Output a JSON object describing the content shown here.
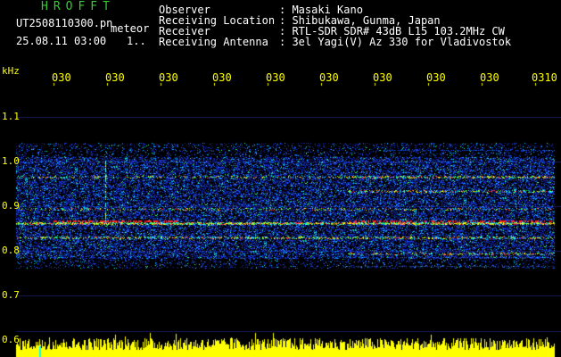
{
  "header": {
    "brand": "HROFFT",
    "file": "UT2508110300.pn",
    "meteor_label": "meteor",
    "datetime": "25.08.11 03:00",
    "count": "1..",
    "fields": [
      {
        "label": "Observer",
        "value": ": Masaki Kano"
      },
      {
        "label": "Receiving Location",
        "value": ": Shibukawa, Gunma, Japan"
      },
      {
        "label": "Receiver",
        "value": ": RTL-SDR SDR# 43dB L15 103.2MHz CW"
      },
      {
        "label": "Receiving Antenna",
        "value": ": 3el Yagi(V) Az 330 for Vladivostok"
      }
    ]
  },
  "axis": {
    "unit": "kHz",
    "y_labels": [
      "1.1",
      "1.0",
      "0.9",
      "0.8",
      "0.7",
      "0.6"
    ],
    "time_ticks": [
      "030",
      "030",
      "030",
      "030",
      "030",
      "030",
      "030",
      "030",
      "030",
      "0310"
    ]
  },
  "colors": {
    "background": "#000000",
    "axis_text": "#ffff00",
    "header_text": "#ffffff",
    "brand": "#33cc33"
  }
}
